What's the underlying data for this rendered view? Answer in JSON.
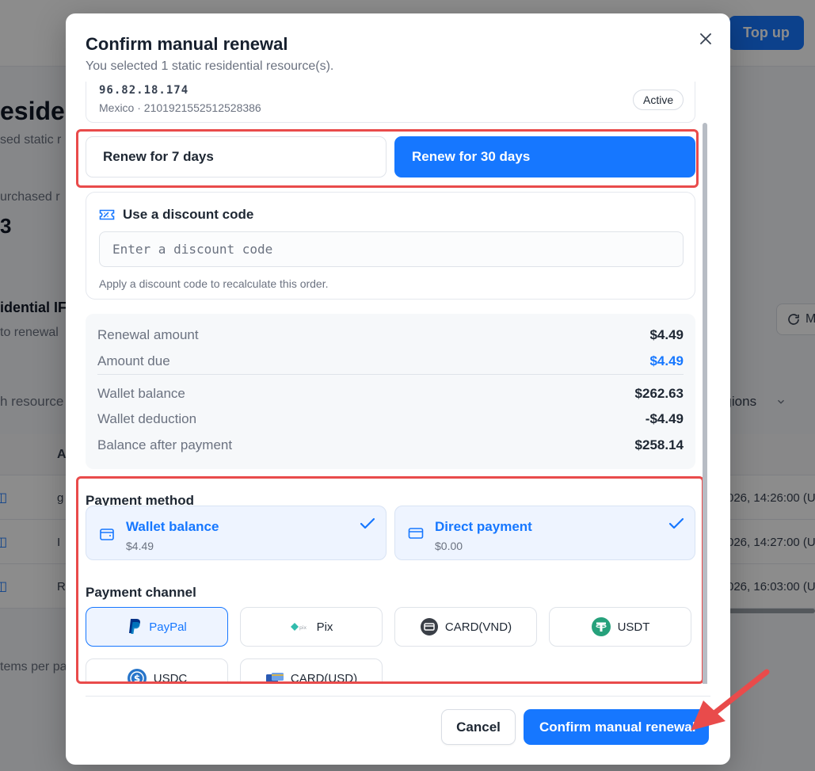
{
  "background": {
    "topup_label": "Top up",
    "heading": "esiden",
    "sub": "sed static r",
    "purchased": "urchased r",
    "count": "3",
    "section_title": "idential IF",
    "section_sub": "to renewal",
    "refresh_label": "M",
    "search_placeholder": "h resource",
    "regions_label": "egions",
    "table_header": "A",
    "rows": [
      {
        "a": "g",
        "date": "026, 14:26:00 (UT"
      },
      {
        "a": "I",
        "date": "026, 14:27:00 (UT"
      },
      {
        "a": "R",
        "date": "026, 16:03:00 (UT"
      }
    ],
    "items_per_page": "tems per pa"
  },
  "modal": {
    "title": "Confirm manual renewal",
    "subtitle": "You selected 1 static residential resource(s).",
    "resource": {
      "ip": "96.82.18.174",
      "meta": "Mexico · 2101921552512528386",
      "status": "Active"
    },
    "renew_options": [
      {
        "label": "Renew for 7 days",
        "selected": false
      },
      {
        "label": "Renew for 30 days",
        "selected": true
      }
    ],
    "discount": {
      "title": "Use a discount code",
      "placeholder": "Enter a discount code",
      "hint": "Apply a discount code to recalculate this order."
    },
    "summary": {
      "renewal_amount_label": "Renewal amount",
      "renewal_amount": "$4.49",
      "amount_due_label": "Amount due",
      "amount_due": "$4.49",
      "wallet_balance_label": "Wallet balance",
      "wallet_balance": "$262.63",
      "wallet_deduction_label": "Wallet deduction",
      "wallet_deduction": "-$4.49",
      "balance_after_label": "Balance after payment",
      "balance_after": "$258.14"
    },
    "payment_method": {
      "label": "Payment method",
      "options": [
        {
          "title": "Wallet balance",
          "amount": "$4.49",
          "icon": "wallet-icon",
          "checked": true
        },
        {
          "title": "Direct payment",
          "amount": "$0.00",
          "icon": "credit-card-icon",
          "checked": true
        }
      ]
    },
    "payment_channel": {
      "label": "Payment channel",
      "options": [
        {
          "label": "PayPal",
          "icon": "paypal-icon",
          "selected": true
        },
        {
          "label": "Pix",
          "icon": "pix-icon",
          "selected": false
        },
        {
          "label": "CARD(VND)",
          "icon": "card-vnd-icon",
          "selected": false
        },
        {
          "label": "USDT",
          "icon": "usdt-icon",
          "selected": false
        },
        {
          "label": "USDC",
          "icon": "usdc-icon",
          "selected": false
        },
        {
          "label": "CARD(USD)",
          "icon": "card-usd-icon",
          "selected": false
        }
      ]
    },
    "cancel_label": "Cancel",
    "confirm_label": "Confirm manual renewal"
  },
  "colors": {
    "primary": "#1677ff",
    "highlight": "#e94b4b",
    "usdt": "#26a17b",
    "usdc": "#2775ca",
    "paypal": "#003087"
  }
}
